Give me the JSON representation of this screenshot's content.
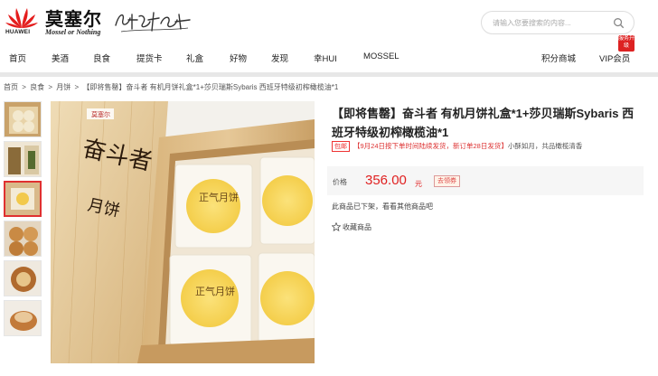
{
  "brand": {
    "huawei_label": "HUAWEI",
    "name_cn": "莫塞尔",
    "name_en": "Mossel or Nothing",
    "slogan_alt": "善待生活"
  },
  "search": {
    "placeholder": "请输入您要搜索的内容..."
  },
  "nav": {
    "left": [
      "首页",
      "美酒",
      "良食",
      "提货卡",
      "礼盒",
      "好物",
      "发现",
      "幸HUI",
      "MOSSEL"
    ],
    "right": [
      "积分商城",
      "VIP会员"
    ],
    "badge": "服务升级"
  },
  "breadcrumb": [
    "首页",
    ">",
    "良食",
    ">",
    "月饼",
    ">",
    "【即将售罄】奋斗者 有机月饼礼盒*1+莎贝瑞斯Sybaris 西班牙特级初榨橄榄油*1"
  ],
  "product": {
    "title": "【即将售罄】奋斗者 有机月饼礼盒*1+莎贝瑞斯Sybaris 西班牙特级初榨橄榄油*1",
    "promo_tag": "包邮",
    "promo_text": "【9月24日按下单时间陆续发货，新订单28日发货】",
    "promo_text2": "小酥如月，共品橄榄清香",
    "price_label": "价格",
    "price": "356.00",
    "currency": "元",
    "coupon": "去领券",
    "off_shelf": "此商品已下架，看看其他商品吧",
    "favorite": "收藏商品"
  },
  "box_text": {
    "lid_big": "奋斗者",
    "lid_small": "月饼",
    "brand_small": "莫塞尔",
    "cake_text": "正气月饼"
  },
  "colors": {
    "accent": "#e02020",
    "nav_bg": "#ffffff",
    "divider": "#e7e7e7"
  }
}
